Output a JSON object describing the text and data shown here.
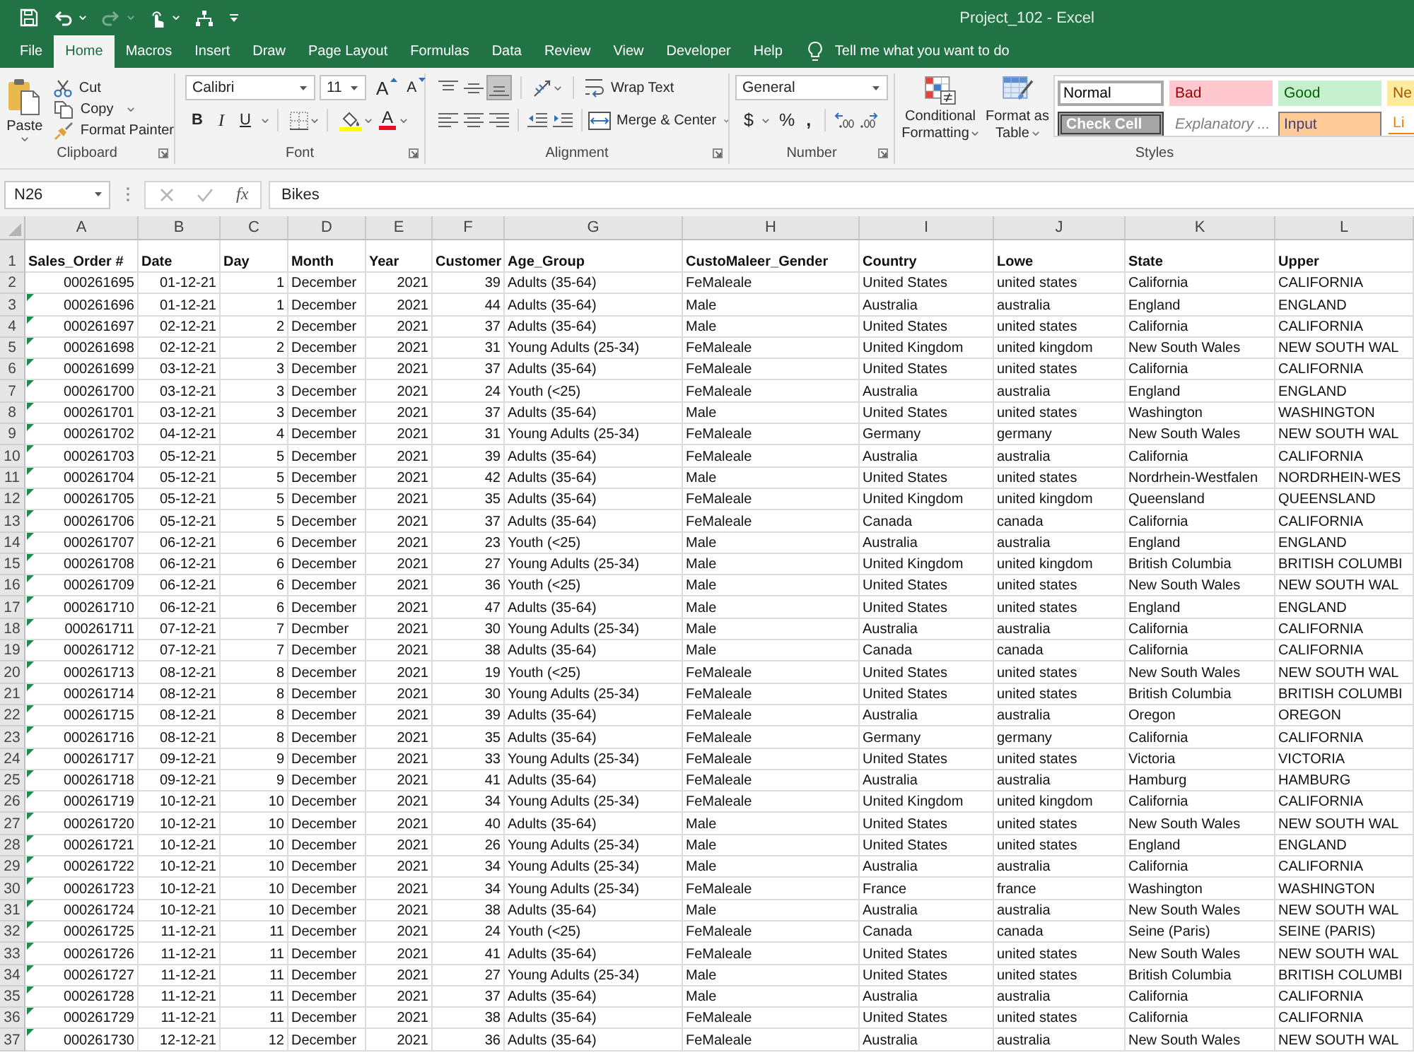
{
  "title_bar": {
    "quick_access": [
      {
        "disabled": false
      },
      {
        "disabled": false
      },
      {
        "disabled": true
      },
      {
        "disabled": false
      },
      {
        "disabled": false
      },
      {
        "disabled": false
      }
    ],
    "title": "Project_102 - Excel"
  },
  "tabs": [
    {
      "label": "File",
      "selected": false
    },
    {
      "label": "Home",
      "selected": true
    },
    {
      "label": "Macros",
      "selected": false
    },
    {
      "label": "Insert",
      "selected": false
    },
    {
      "label": "Draw",
      "selected": false
    },
    {
      "label": "Page Layout",
      "selected": false
    },
    {
      "label": "Formulas",
      "selected": false
    },
    {
      "label": "Data",
      "selected": false
    },
    {
      "label": "Review",
      "selected": false
    },
    {
      "label": "View",
      "selected": false
    },
    {
      "label": "Developer",
      "selected": false
    },
    {
      "label": "Help",
      "selected": false
    }
  ],
  "tell_me": {
    "placeholder": "Tell me what you want to do"
  },
  "ribbon": {
    "clipboard": {
      "label": "Clipboard",
      "paste": "Paste",
      "cut": "Cut",
      "copy": "Copy",
      "format_painter": "Format Painter"
    },
    "font": {
      "label": "Font",
      "font_name": "Calibri",
      "font_size": "11",
      "grow": "A",
      "shrink": "A",
      "bold": "B",
      "italic": "I",
      "underline": "U",
      "font_color": "A"
    },
    "alignment": {
      "label": "Alignment",
      "vertical": [
        {
          "selected": false
        },
        {
          "selected": false
        },
        {
          "selected": true
        }
      ],
      "horizontal": [
        {
          "selected": false
        },
        {
          "selected": false
        },
        {
          "selected": false
        }
      ],
      "wrap_text": "Wrap Text",
      "merge_center": "Merge & Center"
    },
    "number": {
      "label": "Number",
      "format": "General",
      "currency": "$",
      "percent": "%",
      "comma": ","
    },
    "styles": {
      "label": "Styles",
      "conditional_formatting": "Conditional Formatting",
      "format_as_table": "Format as Table",
      "cell_styles": [
        {
          "label": "Normal",
          "kind": "normal",
          "selected": true
        },
        {
          "label": "Bad",
          "kind": "bad",
          "selected": false
        },
        {
          "label": "Good",
          "kind": "good",
          "selected": false
        },
        {
          "label": "Ne",
          "kind": "neutral",
          "selected": false
        },
        {
          "label": "Check Cell",
          "kind": "check",
          "selected": false
        },
        {
          "label": "Explanatory ...",
          "kind": "explanatory",
          "selected": false
        },
        {
          "label": "Input",
          "kind": "input",
          "selected": false
        },
        {
          "label": "Li",
          "kind": "linked",
          "selected": false
        }
      ]
    }
  },
  "formula_bar": {
    "name_box": "N26",
    "insert_function": "fx",
    "content": "Bikes"
  },
  "sheet": {
    "column_letters": [
      "A",
      "B",
      "C",
      "D",
      "E",
      "F",
      "G",
      "H",
      "I",
      "J",
      "K",
      "L"
    ],
    "header_row": {
      "number": "1",
      "cells": [
        "Sales_Order #",
        "Date",
        "Day",
        "Month",
        "Year",
        "Customer",
        "Age_Group",
        "CustoMaleer_Gender",
        "Country",
        "Lowe",
        "State",
        "Upper"
      ]
    },
    "rows": [
      {
        "number": "2",
        "error_indicator": false,
        "cells": [
          "000261695",
          "01-12-21",
          "1",
          "December",
          "2021",
          "39",
          "Adults (35-64)",
          "FeMaleale",
          "United States",
          "united states",
          "California",
          "CALIFORNIA"
        ]
      },
      {
        "number": "3",
        "error_indicator": true,
        "cells": [
          "000261696",
          "01-12-21",
          "1",
          "December",
          "2021",
          "44",
          "Adults (35-64)",
          "Male",
          "Australia",
          "australia",
          "England",
          "ENGLAND"
        ]
      },
      {
        "number": "4",
        "error_indicator": true,
        "cells": [
          "000261697",
          "02-12-21",
          "2",
          "December",
          "2021",
          "37",
          "Adults (35-64)",
          "Male",
          "United States",
          "united states",
          "California",
          "CALIFORNIA"
        ]
      },
      {
        "number": "5",
        "error_indicator": true,
        "cells": [
          "000261698",
          "02-12-21",
          "2",
          "December",
          "2021",
          "31",
          "Young Adults (25-34)",
          "FeMaleale",
          "United Kingdom",
          "united kingdom",
          "New South Wales",
          "NEW SOUTH WAL"
        ]
      },
      {
        "number": "6",
        "error_indicator": true,
        "cells": [
          "000261699",
          "03-12-21",
          "3",
          "December",
          "2021",
          "37",
          "Adults (35-64)",
          "FeMaleale",
          "United States",
          "united states",
          "California",
          "CALIFORNIA"
        ]
      },
      {
        "number": "7",
        "error_indicator": true,
        "cells": [
          "000261700",
          "03-12-21",
          "3",
          "December",
          "2021",
          "24",
          "Youth (<25)",
          "FeMaleale",
          "Australia",
          "australia",
          "England",
          "ENGLAND"
        ]
      },
      {
        "number": "8",
        "error_indicator": true,
        "cells": [
          "000261701",
          "03-12-21",
          "3",
          "December",
          "2021",
          "37",
          "Adults (35-64)",
          "Male",
          "United States",
          "united states",
          "Washington",
          "WASHINGTON"
        ]
      },
      {
        "number": "9",
        "error_indicator": true,
        "cells": [
          "000261702",
          "04-12-21",
          "4",
          "December",
          "2021",
          "31",
          "Young Adults (25-34)",
          "FeMaleale",
          "Germany",
          "germany",
          "New South Wales",
          "NEW SOUTH WAL"
        ]
      },
      {
        "number": "10",
        "error_indicator": true,
        "cells": [
          "000261703",
          "05-12-21",
          "5",
          "December",
          "2021",
          "39",
          "Adults (35-64)",
          "FeMaleale",
          "Australia",
          "australia",
          "California",
          "CALIFORNIA"
        ]
      },
      {
        "number": "11",
        "error_indicator": true,
        "cells": [
          "000261704",
          "05-12-21",
          "5",
          "December",
          "2021",
          "42",
          "Adults (35-64)",
          "Male",
          "United States",
          "united states",
          "Nordrhein-Westfalen",
          "NORDRHEIN-WES"
        ]
      },
      {
        "number": "12",
        "error_indicator": true,
        "cells": [
          "000261705",
          "05-12-21",
          "5",
          "December",
          "2021",
          "35",
          "Adults (35-64)",
          "FeMaleale",
          "United Kingdom",
          "united kingdom",
          "Queensland",
          "QUEENSLAND"
        ]
      },
      {
        "number": "13",
        "error_indicator": true,
        "cells": [
          "000261706",
          "05-12-21",
          "5",
          "December",
          "2021",
          "37",
          "Adults (35-64)",
          "FeMaleale",
          "Canada",
          "canada",
          "California",
          "CALIFORNIA"
        ]
      },
      {
        "number": "14",
        "error_indicator": true,
        "cells": [
          "000261707",
          "06-12-21",
          "6",
          "December",
          "2021",
          "23",
          "Youth (<25)",
          "Male",
          "Australia",
          "australia",
          "England",
          "ENGLAND"
        ]
      },
      {
        "number": "15",
        "error_indicator": true,
        "cells": [
          "000261708",
          "06-12-21",
          "6",
          "December",
          "2021",
          "27",
          "Young Adults (25-34)",
          "Male",
          "United Kingdom",
          "united kingdom",
          "British Columbia",
          "BRITISH COLUMBI"
        ]
      },
      {
        "number": "16",
        "error_indicator": true,
        "cells": [
          "000261709",
          "06-12-21",
          "6",
          "December",
          "2021",
          "36",
          "Youth (<25)",
          "Male",
          "United States",
          "united states",
          "New South Wales",
          "NEW SOUTH WAL"
        ]
      },
      {
        "number": "17",
        "error_indicator": true,
        "cells": [
          "000261710",
          "06-12-21",
          "6",
          "December",
          "2021",
          "47",
          "Adults (35-64)",
          "Male",
          "United States",
          "united states",
          "England",
          "ENGLAND"
        ]
      },
      {
        "number": "18",
        "error_indicator": true,
        "cells": [
          "000261711",
          "07-12-21",
          "7",
          "Decmber",
          "2021",
          "30",
          "Young Adults (25-34)",
          "Male",
          "Australia",
          "australia",
          "California",
          "CALIFORNIA"
        ]
      },
      {
        "number": "19",
        "error_indicator": true,
        "cells": [
          "000261712",
          "07-12-21",
          "7",
          "December",
          "2021",
          "38",
          "Adults (35-64)",
          "Male",
          "Canada",
          "canada",
          "California",
          "CALIFORNIA"
        ]
      },
      {
        "number": "20",
        "error_indicator": true,
        "cells": [
          "000261713",
          "08-12-21",
          "8",
          "December",
          "2021",
          "19",
          "Youth (<25)",
          "FeMaleale",
          "United States",
          "united states",
          "New South Wales",
          "NEW SOUTH WAL"
        ]
      },
      {
        "number": "21",
        "error_indicator": true,
        "cells": [
          "000261714",
          "08-12-21",
          "8",
          "December",
          "2021",
          "30",
          "Young Adults (25-34)",
          "FeMaleale",
          "United States",
          "united states",
          "British Columbia",
          "BRITISH COLUMBI"
        ]
      },
      {
        "number": "22",
        "error_indicator": true,
        "cells": [
          "000261715",
          "08-12-21",
          "8",
          "December",
          "2021",
          "39",
          "Adults (35-64)",
          "FeMaleale",
          "Australia",
          "australia",
          "Oregon",
          "OREGON"
        ]
      },
      {
        "number": "23",
        "error_indicator": true,
        "cells": [
          "000261716",
          "08-12-21",
          "8",
          "December",
          "2021",
          "35",
          "Adults (35-64)",
          "FeMaleale",
          "Germany",
          "germany",
          "California",
          "CALIFORNIA"
        ]
      },
      {
        "number": "24",
        "error_indicator": true,
        "cells": [
          "000261717",
          "09-12-21",
          "9",
          "December",
          "2021",
          "33",
          "Young Adults (25-34)",
          "FeMaleale",
          "United States",
          "united states",
          "Victoria",
          "VICTORIA"
        ]
      },
      {
        "number": "25",
        "error_indicator": true,
        "cells": [
          "000261718",
          "09-12-21",
          "9",
          "December",
          "2021",
          "41",
          "Adults (35-64)",
          "FeMaleale",
          "Australia",
          "australia",
          "Hamburg",
          "HAMBURG"
        ]
      },
      {
        "number": "26",
        "error_indicator": true,
        "cells": [
          "000261719",
          "10-12-21",
          "10",
          "December",
          "2021",
          "34",
          "Young Adults (25-34)",
          "FeMaleale",
          "United Kingdom",
          "united kingdom",
          "California",
          "CALIFORNIA"
        ]
      },
      {
        "number": "27",
        "error_indicator": true,
        "cells": [
          "000261720",
          "10-12-21",
          "10",
          "December",
          "2021",
          "40",
          "Adults (35-64)",
          "Male",
          "United States",
          "united states",
          "New South Wales",
          "NEW SOUTH WAL"
        ]
      },
      {
        "number": "28",
        "error_indicator": true,
        "cells": [
          "000261721",
          "10-12-21",
          "10",
          "December",
          "2021",
          "26",
          "Young Adults (25-34)",
          "Male",
          "United States",
          "united states",
          "England",
          "ENGLAND"
        ]
      },
      {
        "number": "29",
        "error_indicator": true,
        "cells": [
          "000261722",
          "10-12-21",
          "10",
          "December",
          "2021",
          "34",
          "Young Adults (25-34)",
          "Male",
          "Australia",
          "australia",
          "California",
          "CALIFORNIA"
        ]
      },
      {
        "number": "30",
        "error_indicator": true,
        "cells": [
          "000261723",
          "10-12-21",
          "10",
          "December",
          "2021",
          "34",
          "Young Adults (25-34)",
          "FeMaleale",
          "France",
          "france",
          "Washington",
          "WASHINGTON"
        ]
      },
      {
        "number": "31",
        "error_indicator": true,
        "cells": [
          "000261724",
          "10-12-21",
          "10",
          "December",
          "2021",
          "38",
          "Adults (35-64)",
          "Male",
          "Australia",
          "australia",
          "New South Wales",
          "NEW SOUTH WAL"
        ]
      },
      {
        "number": "32",
        "error_indicator": true,
        "cells": [
          "000261725",
          "11-12-21",
          "11",
          "December",
          "2021",
          "24",
          "Youth (<25)",
          "FeMaleale",
          "Canada",
          "canada",
          "Seine (Paris)",
          "SEINE (PARIS)"
        ]
      },
      {
        "number": "33",
        "error_indicator": true,
        "cells": [
          "000261726",
          "11-12-21",
          "11",
          "December",
          "2021",
          "41",
          "Adults (35-64)",
          "FeMaleale",
          "United States",
          "united states",
          "New South Wales",
          "NEW SOUTH WAL"
        ]
      },
      {
        "number": "34",
        "error_indicator": true,
        "cells": [
          "000261727",
          "11-12-21",
          "11",
          "December",
          "2021",
          "27",
          "Young Adults (25-34)",
          "Male",
          "United States",
          "united states",
          "British Columbia",
          "BRITISH COLUMBI"
        ]
      },
      {
        "number": "35",
        "error_indicator": true,
        "cells": [
          "000261728",
          "11-12-21",
          "11",
          "December",
          "2021",
          "37",
          "Adults (35-64)",
          "Male",
          "Australia",
          "australia",
          "California",
          "CALIFORNIA"
        ]
      },
      {
        "number": "36",
        "error_indicator": true,
        "cells": [
          "000261729",
          "11-12-21",
          "11",
          "December",
          "2021",
          "38",
          "Adults (35-64)",
          "FeMaleale",
          "United States",
          "united states",
          "California",
          "CALIFORNIA"
        ]
      },
      {
        "number": "37",
        "error_indicator": true,
        "cells": [
          "000261730",
          "12-12-21",
          "12",
          "December",
          "2021",
          "36",
          "Adults (35-64)",
          "FeMaleale",
          "Australia",
          "australia",
          "New South Wales",
          "NEW SOUTH WAL"
        ]
      }
    ]
  }
}
